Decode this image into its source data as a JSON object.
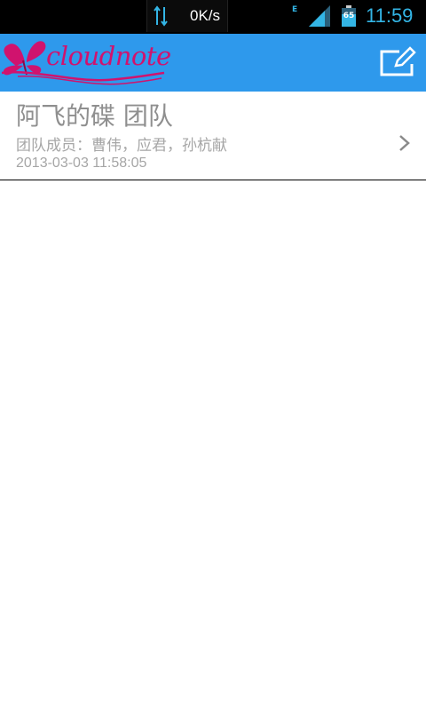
{
  "status_bar": {
    "network_speed": "0K/s",
    "network_type": "E",
    "battery_level": "65",
    "time": "11:59"
  },
  "app_bar": {
    "logo_text": "cloudnote",
    "compose_icon": "compose-icon"
  },
  "teams": [
    {
      "name": "阿飞的碟 团队",
      "members": "团队成员：曹伟，应君，孙杭献",
      "date": "2013-03-03 11:58:05"
    }
  ],
  "colors": {
    "app_bar": "#2e99ec",
    "logo": "#d0136e",
    "clock": "#33b5e5"
  }
}
